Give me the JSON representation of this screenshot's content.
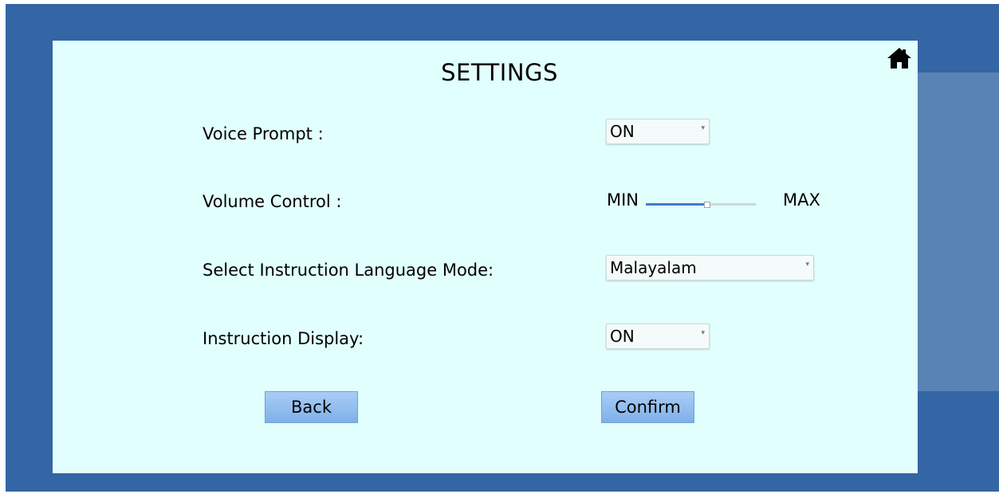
{
  "title": "SETTINGS",
  "voice_prompt": {
    "label": "Voice Prompt :",
    "value": "ON"
  },
  "volume": {
    "label": "Volume Control :",
    "min_label": "MIN",
    "max_label": "MAX",
    "level": 0.55
  },
  "language": {
    "label": "Select Instruction Language Mode:",
    "value": "Malayalam"
  },
  "instruction_display": {
    "label": "Instruction Display:",
    "value": "ON"
  },
  "buttons": {
    "back": "Back",
    "confirm": "Confirm"
  },
  "icons": {
    "home": "home-icon"
  },
  "colors": {
    "background": "#3465a4",
    "panel": "#e1fffd",
    "button": "#8ebcf0",
    "slider_fill": "#3b7fcc"
  }
}
